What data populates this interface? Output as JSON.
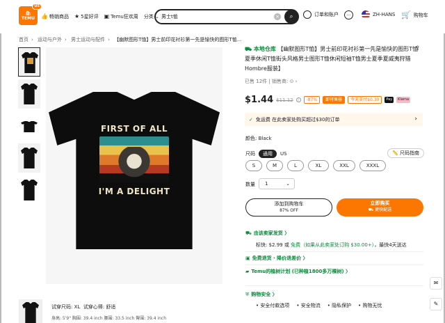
{
  "header": {
    "logo_line1": "TEMU",
    "logo_badge": "US",
    "nav": [
      {
        "icon": "fire-icon",
        "label": "畅销商品"
      },
      {
        "icon": "star-icon",
        "label": "5星好评"
      },
      {
        "icon": "tag-icon",
        "label": "Temu狂欢周"
      },
      {
        "icon": "",
        "label": "分类 ⌄"
      }
    ],
    "search_value": "男士t恤",
    "account_label": "订单和账户",
    "language": "ZH-HANS",
    "cart_label": "购物车"
  },
  "breadcrumb": [
    "首页",
    "运动与户外",
    "男士运动与配件",
    "【幽默图形T恤】男士前印花衬衫第一先是愉快的图形T恤..."
  ],
  "product": {
    "store_badge": "本地仓库",
    "title": "【幽默图形T恤】男士前印花衬衫第一先是愉快的图形T恤夏季休闲T恤街头风格男士图形T恤休闲短袖T恤男士夏季夏威夷狩猎Hombre服装】",
    "sold_prefix": "已售",
    "sold_count": "12件",
    "seller_label": "销售商:",
    "price": "$1.44",
    "old_price": "$11.12",
    "discount": "-87%",
    "badge_flash": "即将售罄",
    "badge_pay": "今天支付$0.30",
    "pay_apple": "Pay",
    "pay_klarna": "Klarna",
    "free_ship": "免运费 在此卖家处购买超过$30的订单",
    "print_line1": "FIRST OF ALL",
    "print_line2": "I'M A DELIGHT",
    "color_label": "颜色:",
    "color_value": "Black",
    "size_label": "尺码",
    "size_tog_on": "通用",
    "size_tog_off": "US",
    "size_guide": "尺码指南",
    "sizes": [
      "S",
      "M",
      "L",
      "XL",
      "XXL",
      "XXXL"
    ],
    "qty_label": "数量",
    "qty_value": "1",
    "add_cart": "添加到购物车",
    "add_cart_sub": "87% OFF",
    "buy_now": "立即购买",
    "buy_now_sub": "更快配送"
  },
  "shipping": {
    "seller_ship": "由该卖家发货 〉",
    "std_label": "标快:",
    "std_price": "$2.99",
    "std_or": "或",
    "std_free": "免费（如果从此卖家处订购 $30.00+）",
    "std_eta": "，最快4天送达",
    "returns": "免费退货 · 降价退差价 〉",
    "tree": "Temu的植树计划 (已种植1800多万棵树) 〉",
    "safe": "购物安全 〉",
    "safe_items": [
      "安全付款选项",
      "安全物流",
      "隐私保护",
      "购物无忧"
    ]
  },
  "review": {
    "size_label": "试穿尺码: XL",
    "feel_label": "试穿心得: 舒适",
    "body": "身高: 5'9\"  胸围: 39.4 inch  腰围: 33.5 inch  臀围: 39.4 inch"
  }
}
